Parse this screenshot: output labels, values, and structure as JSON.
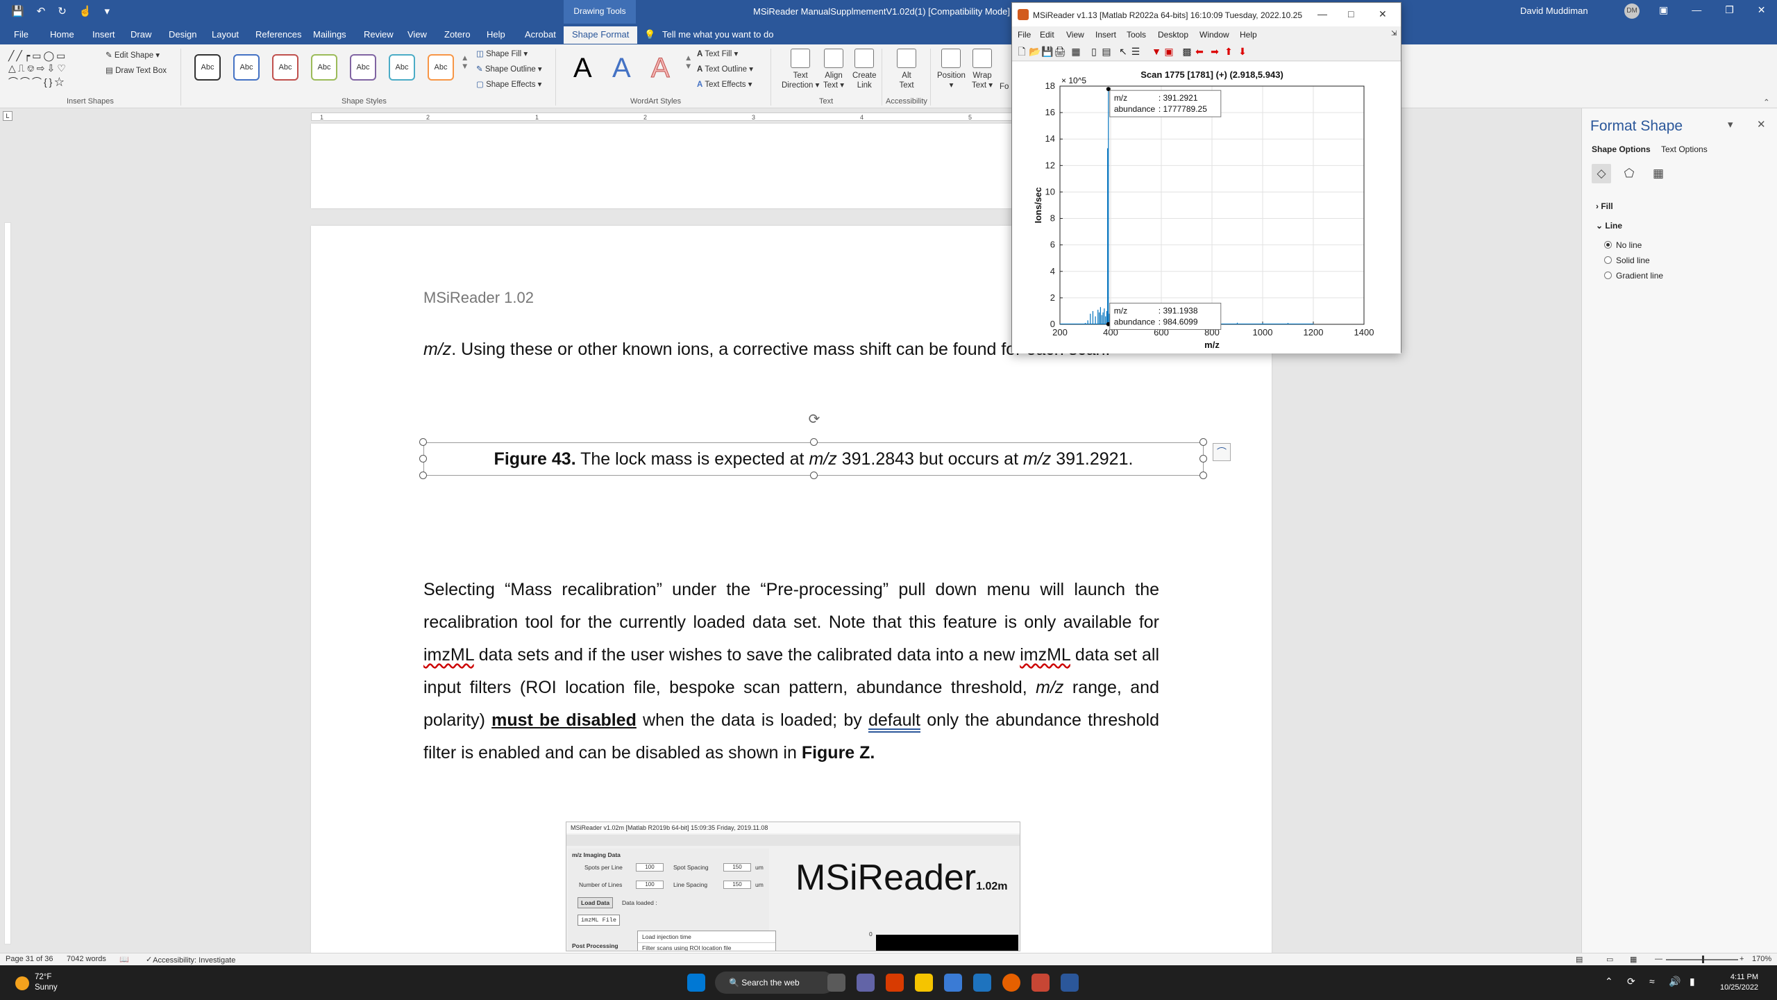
{
  "titlebar": {
    "doc_title": "MSiReader ManualSupplmementV1.02d(1) [Compatibility Mode] - W",
    "drawing_tools": "Drawing Tools",
    "tell_me": "Tell me what you want to do",
    "user_name": "David Muddiman",
    "user_initials": "DM"
  },
  "tabs": [
    "File",
    "Home",
    "Insert",
    "Draw",
    "Design",
    "Layout",
    "References",
    "Mailings",
    "Review",
    "View",
    "Zotero",
    "Help",
    "Acrobat"
  ],
  "active_tab": "Shape Format",
  "ribbon": {
    "insert_shapes": {
      "edit_shape": "Edit Shape",
      "draw_text_box": "Draw Text Box",
      "label": "Insert Shapes"
    },
    "shape_styles": {
      "swatches": [
        "Abc",
        "Abc",
        "Abc",
        "Abc",
        "Abc",
        "Abc",
        "Abc"
      ],
      "swatch_colors": [
        "#333333",
        "#4472c4",
        "#c0504d",
        "#9bbb59",
        "#8064a2",
        "#4bacc6",
        "#f79646"
      ],
      "fill": "Shape Fill",
      "outline": "Shape Outline",
      "effects": "Shape Effects",
      "label": "Shape Styles"
    },
    "wordart": {
      "letters": [
        "A",
        "A",
        "A"
      ],
      "text_fill": "Text Fill",
      "text_outline": "Text Outline",
      "text_effects": "Text Effects",
      "label": "WordArt Styles"
    },
    "text": {
      "direction": "Text\nDirection",
      "align": "Align\nText",
      "link": "Create\nLink",
      "label": "Text"
    },
    "accessibility": {
      "alt_text": "Alt\nText",
      "label": "Accessibility"
    },
    "arrange": {
      "position": "Position",
      "wrap": "Wrap\nText",
      "forward": "Fo"
    }
  },
  "document": {
    "header": "MSiReader 1.02",
    "para1_italic": "m/z",
    "para1": ". Using these or other known ions, a corrective mass shift can be found for each scan.",
    "caption_bold": "Figure 43.",
    "caption_a": " The lock mass is expected at ",
    "caption_mz1": "m/z",
    "caption_b": " 391.2843 but occurs at ",
    "caption_mz2": "m/z",
    "caption_c": " 391.2921.",
    "para2_a": "Selecting “Mass recalibration” under the “Pre-processing” pull down menu will launch the recalibration tool for the currently loaded data set. Note that this feature is only available for ",
    "imzml1": "imzML",
    "para2_b": " data sets and if the user wishes to save the calibrated data into a new ",
    "imzml2": "imzML",
    "para2_c": " data set all input filters (ROI location file, bespoke scan pattern, abundance threshold, ",
    "para2_mz": "m/z",
    "para2_d": " range, and polarity) ",
    "para2_bold": "must be disabled",
    "para2_e": " when the data is loaded; by ",
    "para2_default": "default",
    "para2_f": " only the abundance threshold filter is enabled and can be disabled as shown in ",
    "para2_fig": "Figure Z."
  },
  "embedded": {
    "title": "MSiReader  v1.02m  [Matlab R2019b 64-bit]  15:09:35 Friday, 2019.11.08",
    "section": "m/z Imaging Data",
    "spots_per_line": "Spots per Line",
    "spots_val": "100",
    "spot_spacing": "Spot Spacing",
    "spot_spacing_val": "150",
    "unit1": "um",
    "num_lines": "Number of Lines",
    "num_lines_val": "100",
    "line_spacing": "Line Spacing",
    "line_spacing_val": "150",
    "unit2": "um",
    "load_data": "Load Data",
    "data_loaded": "Data loaded :",
    "file_type": "imzML File",
    "post_processing": "Post Processing",
    "menu_item1": "Load injection time",
    "menu_item2": "Filter scans using ROI location file",
    "brand": "MSiReader",
    "brand_version": "1.02m",
    "zero": "0"
  },
  "format_pane": {
    "title": "Format Shape",
    "tab_shape": "Shape Options",
    "tab_text": "Text Options",
    "fill": "Fill",
    "line": "Line",
    "options": [
      "No line",
      "Solid line",
      "Gradient line"
    ],
    "selected": "No line"
  },
  "msireader": {
    "title": "MSiReader  v1.13  [Matlab R2022a 64-bits]  16:10:09 Tuesday, 2022.10.25",
    "menu": [
      "File",
      "Edit",
      "View",
      "Insert",
      "Tools",
      "Desktop",
      "Window",
      "Help"
    ]
  },
  "chart_data": {
    "type": "line",
    "title": "Scan 1775 [1781] (+)  (2.918,5.943)",
    "xlabel": "m/z",
    "ylabel": "Ions/sec",
    "y_exponent": "× 10^5",
    "xlim": [
      200,
      1400
    ],
    "ylim": [
      0,
      18
    ],
    "xticks": [
      200,
      400,
      600,
      800,
      1000,
      1200,
      1400
    ],
    "yticks": [
      0,
      2,
      4,
      6,
      8,
      10,
      12,
      14,
      16,
      18
    ],
    "grid": true,
    "series": [
      {
        "x": [
          300,
          310,
          320,
          330,
          340,
          350,
          355,
          360,
          365,
          370,
          375,
          380,
          385,
          388,
          391.19,
          391.29,
          395,
          400,
          410,
          420,
          440,
          460,
          500,
          600,
          700,
          800,
          900,
          1000,
          1100,
          1200
        ],
        "values": [
          0.1,
          0.3,
          0.8,
          1.0,
          0.6,
          1.1,
          0.9,
          1.3,
          0.7,
          0.9,
          1.2,
          0.6,
          1.0,
          13.3,
          0.01,
          17.78,
          0.8,
          0.6,
          0.4,
          0.3,
          0.2,
          0.15,
          0.1,
          0.1,
          0.1,
          0.2,
          0.12,
          0.1,
          0.1,
          0.05
        ]
      }
    ],
    "datatips": [
      {
        "mz_label": "m/z",
        "mz": "391.2921",
        "ab_label": "abundance",
        "ab": "1777789.25"
      },
      {
        "mz_label": "m/z",
        "mz": "391.1938",
        "ab_label": "abundance",
        "ab": "984.6099"
      }
    ]
  },
  "statusbar": {
    "page": "Page 31 of 36",
    "words": "7042 words",
    "accessibility": "Accessibility: Investigate",
    "zoom": "170%"
  },
  "taskbar": {
    "temp": "72°F",
    "condition": "Sunny",
    "search": "Search the web",
    "time": "4:11 PM",
    "date": "10/25/2022"
  }
}
